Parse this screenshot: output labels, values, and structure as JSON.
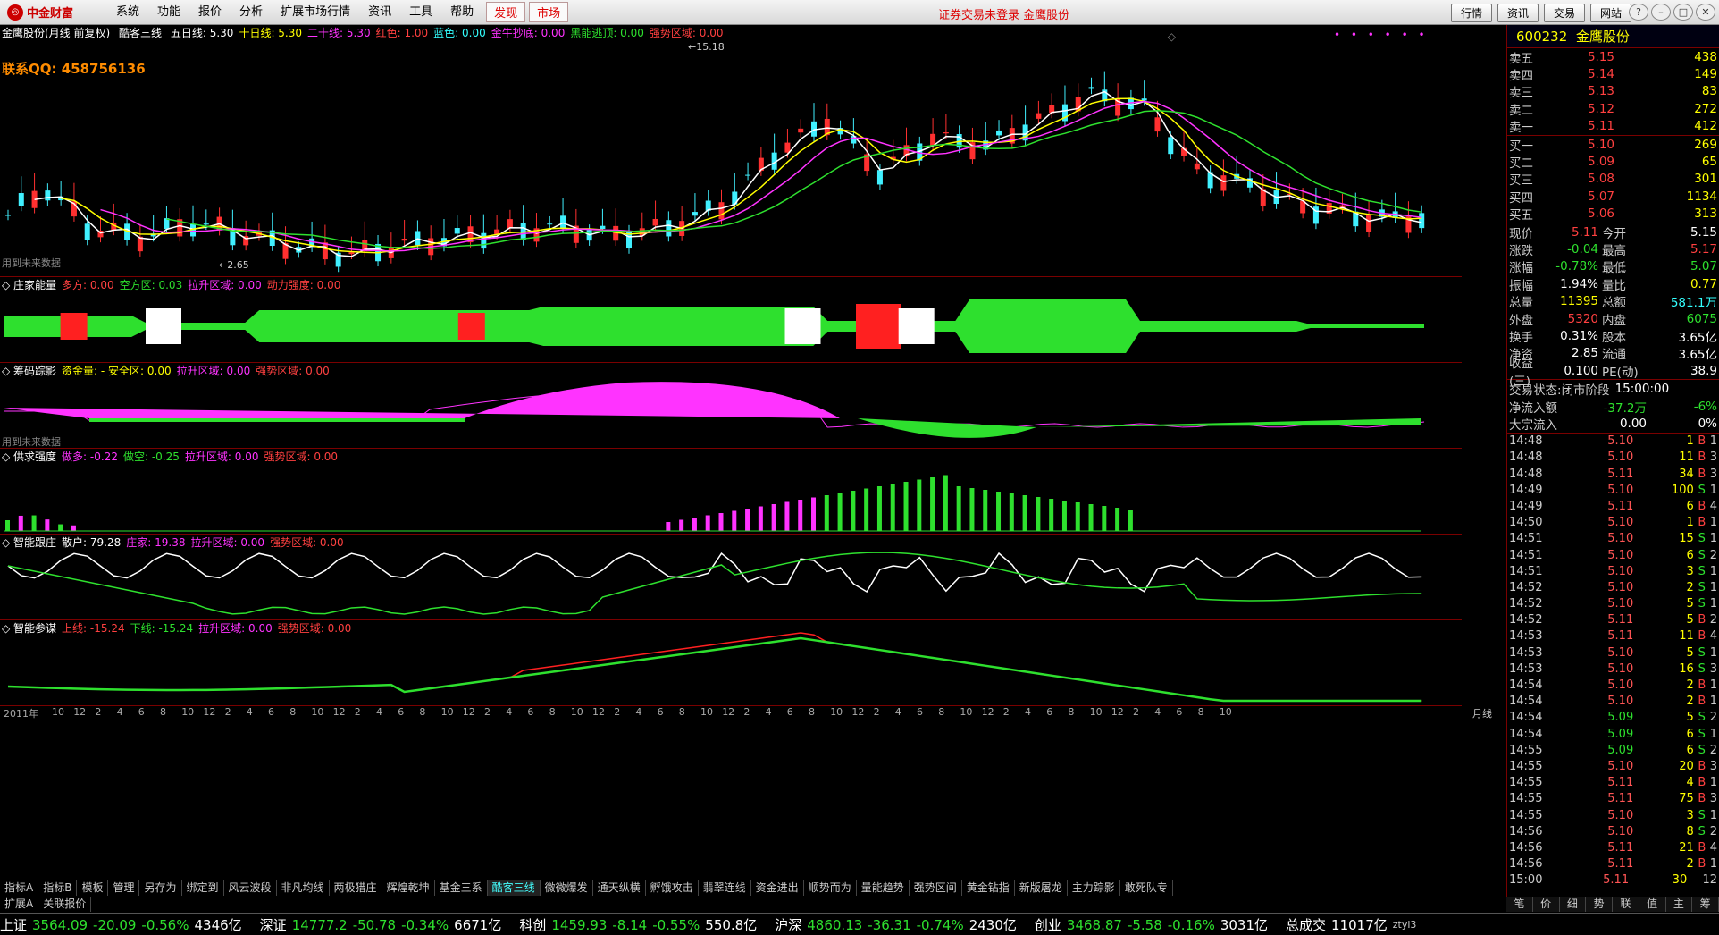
{
  "menu": {
    "logo": "中金财富",
    "items": [
      "系统",
      "功能",
      "报价",
      "分析",
      "扩展市场行情",
      "资讯",
      "工具",
      "帮助"
    ],
    "hot": [
      "发现",
      "市场"
    ],
    "login": "证券交易未登录 金鹰股份",
    "right_buttons": [
      "行情",
      "资讯",
      "交易",
      "网站"
    ]
  },
  "main": {
    "title": "金鹰股份(月线 前复权)",
    "indicator": "酷客三线",
    "lines": [
      {
        "t": "五日线: 5.30",
        "c": "#ffffff"
      },
      {
        "t": "十日线: 5.30",
        "c": "#ffff00"
      },
      {
        "t": "二十线: 5.30",
        "c": "#ff33ff"
      },
      {
        "t": "红色: 1.00",
        "c": "#ff4040"
      },
      {
        "t": "蓝色: 0.00",
        "c": "#33ffff"
      },
      {
        "t": "金牛抄底: 0.00",
        "c": "#ff33ff"
      },
      {
        "t": "黑能逃顶: 0.00",
        "c": "#2ee02e"
      },
      {
        "t": "强势区域: 0.00",
        "c": "#ff4040"
      }
    ],
    "contact": "联系QQ:  458756136",
    "high": "15.18",
    "low": "2.65",
    "future": "用到未来数据",
    "yscale": [
      "14.00",
      "12.00",
      "10.00",
      "8.00",
      "6.00",
      "4.00"
    ]
  },
  "panes": [
    {
      "name": "庄家能量",
      "lines": [
        {
          "t": "多方: 0.00",
          "c": "#ff4040"
        },
        {
          "t": "空方区: 0.03",
          "c": "#2ee02e"
        },
        {
          "t": "拉升区域: 0.00",
          "c": "#ff33ff"
        },
        {
          "t": "动力强度: 0.00",
          "c": "#ff4040"
        }
      ],
      "yscale": [
        "1.00",
        "0.00"
      ]
    },
    {
      "name": "筹码踪影",
      "lines": [
        {
          "t": "资金量: - 安全区: 0.00",
          "c": "#ffff00"
        },
        {
          "t": "拉升区域: 0.00",
          "c": "#ff33ff"
        },
        {
          "t": "强势区域: 0.00",
          "c": "#ff4040"
        }
      ],
      "yscale": [
        "3.00",
        "1.50"
      ],
      "future": "用到未来数据"
    },
    {
      "name": "供求强度",
      "lines": [
        {
          "t": "做多: -0.22",
          "c": "#ff33ff"
        },
        {
          "t": "做空: -0.25",
          "c": "#2ee02e"
        },
        {
          "t": "拉升区域: 0.00",
          "c": "#ff33ff"
        },
        {
          "t": "强势区域: 0.00",
          "c": "#ff4040"
        }
      ],
      "yscale": [
        "2.00",
        "1.00",
        "0.00"
      ]
    },
    {
      "name": "智能跟庄",
      "lines": [
        {
          "t": "散户: 79.28",
          "c": "#ffffff"
        },
        {
          "t": "庄家: 19.38",
          "c": "#ff33ff"
        },
        {
          "t": "拉升区域: 0.00",
          "c": "#ff33ff"
        },
        {
          "t": "强势区域: 0.00",
          "c": "#ff4040"
        }
      ],
      "yscale": [
        "75.00",
        "50.00",
        "25.00"
      ]
    },
    {
      "name": "智能参谋",
      "lines": [
        {
          "t": "上线: -15.24",
          "c": "#ff4040"
        },
        {
          "t": "下线: -15.24",
          "c": "#2ee02e"
        },
        {
          "t": "拉升区域: 0.00",
          "c": "#ff33ff"
        },
        {
          "t": "强势区域: 0.00",
          "c": "#ff4040"
        }
      ],
      "yscale": [
        "75.00",
        "50.00",
        "25.00"
      ]
    }
  ],
  "xaxis": {
    "first": "2011年",
    "period": "月线",
    "labels": [
      "10",
      "12",
      "2",
      "4",
      "6",
      "8",
      "10",
      "12",
      "2",
      "4",
      "6",
      "8",
      "10",
      "12",
      "2",
      "4",
      "6",
      "8",
      "10",
      "12",
      "2",
      "4",
      "6",
      "8",
      "10",
      "12",
      "2",
      "4",
      "6",
      "8",
      "10",
      "12",
      "2",
      "4",
      "6",
      "8",
      "10",
      "12",
      "2",
      "4",
      "6",
      "8",
      "10",
      "12",
      "2",
      "4",
      "6",
      "8",
      "10",
      "12",
      "2",
      "4",
      "6",
      "8",
      "10"
    ]
  },
  "tabs": [
    "指标A",
    "指标B",
    "模板",
    "管理",
    "另存为",
    "绑定到",
    "风云波段",
    "非凡均线",
    "两极猎庄",
    "辉煌乾坤",
    "基金三系",
    "酷客三线",
    "微微爆发",
    "通天纵横",
    "孵饿攻击",
    "翡翠连线",
    "资金进出",
    "顺势而为",
    "量能趋势",
    "强势区间",
    "黄金钻指",
    "新版屠龙",
    "主力踪影",
    "敢死队专"
  ],
  "active_tab": "酷客三线",
  "subtabs": [
    "扩展A",
    "关联报价"
  ],
  "right_tabs": [
    "笔",
    "价",
    "细",
    "势",
    "联",
    "值",
    "主",
    "筹"
  ],
  "quote": {
    "code": "600232",
    "name": "金鹰股份",
    "sells": [
      {
        "k": "卖五",
        "p": "5.15",
        "v": "438"
      },
      {
        "k": "卖四",
        "p": "5.14",
        "v": "149"
      },
      {
        "k": "卖三",
        "p": "5.13",
        "v": "83"
      },
      {
        "k": "卖二",
        "p": "5.12",
        "v": "272"
      },
      {
        "k": "卖一",
        "p": "5.11",
        "v": "412"
      }
    ],
    "buys": [
      {
        "k": "买一",
        "p": "5.10",
        "v": "269"
      },
      {
        "k": "买二",
        "p": "5.09",
        "v": "65"
      },
      {
        "k": "买三",
        "p": "5.08",
        "v": "301"
      },
      {
        "k": "买四",
        "p": "5.07",
        "v": "1134"
      },
      {
        "k": "买五",
        "p": "5.06",
        "v": "313"
      }
    ],
    "stats": [
      {
        "k": "现价",
        "v": "5.11",
        "vc": "#ff4040",
        "k2": "今开",
        "v2": "5.15",
        "v2c": "#ffffff"
      },
      {
        "k": "涨跌",
        "v": "-0.04",
        "vc": "#2ee02e",
        "k2": "最高",
        "v2": "5.17",
        "v2c": "#ff4040"
      },
      {
        "k": "涨幅",
        "v": "-0.78%",
        "vc": "#2ee02e",
        "k2": "最低",
        "v2": "5.07",
        "v2c": "#2ee02e"
      },
      {
        "k": "振幅",
        "v": "1.94%",
        "vc": "#ffffff",
        "k2": "量比",
        "v2": "0.77",
        "v2c": "#ffff00"
      },
      {
        "k": "总量",
        "v": "11395",
        "vc": "#ffff00",
        "k2": "总额",
        "v2": "581.1万",
        "v2c": "#33ffff"
      },
      {
        "k": "外盘",
        "v": "5320",
        "vc": "#ff4040",
        "k2": "内盘",
        "v2": "6075",
        "v2c": "#2ee02e"
      },
      {
        "k": "换手",
        "v": "0.31%",
        "vc": "#ffffff",
        "k2": "股本",
        "v2": "3.65亿",
        "v2c": "#ffffff"
      },
      {
        "k": "净资",
        "v": "2.85",
        "vc": "#ffffff",
        "k2": "流通",
        "v2": "3.65亿",
        "v2c": "#ffffff"
      },
      {
        "k": "收益(三)",
        "v": "0.100",
        "vc": "#ffffff",
        "k2": "PE(动)",
        "v2": "38.9",
        "v2c": "#ffffff"
      }
    ],
    "state_label": "交易状态:",
    "state": "闭市阶段",
    "state_time": "15:00:00",
    "flow": [
      {
        "k": "净流入额",
        "v": "-37.2万",
        "vc": "#2ee02e",
        "r": "-6%",
        "rc": "#2ee02e"
      },
      {
        "k": "大宗流入",
        "v": "0.00",
        "vc": "#ffffff",
        "r": "0%",
        "rc": "#ffffff"
      }
    ],
    "ticks": [
      [
        "14:48",
        "5.10",
        "1",
        "B",
        "1"
      ],
      [
        "14:48",
        "5.10",
        "11",
        "B",
        "3"
      ],
      [
        "14:48",
        "5.11",
        "34",
        "B",
        "3"
      ],
      [
        "14:49",
        "5.10",
        "100",
        "S",
        "1"
      ],
      [
        "14:49",
        "5.11",
        "6",
        "B",
        "4"
      ],
      [
        "14:50",
        "5.10",
        "1",
        "B",
        "1"
      ],
      [
        "14:51",
        "5.10",
        "15",
        "S",
        "1"
      ],
      [
        "14:51",
        "5.10",
        "6",
        "S",
        "2"
      ],
      [
        "14:51",
        "5.10",
        "3",
        "S",
        "1"
      ],
      [
        "14:52",
        "5.10",
        "2",
        "S",
        "1"
      ],
      [
        "14:52",
        "5.10",
        "5",
        "S",
        "1"
      ],
      [
        "14:52",
        "5.11",
        "5",
        "B",
        "2"
      ],
      [
        "14:53",
        "5.11",
        "11",
        "B",
        "4"
      ],
      [
        "14:53",
        "5.10",
        "5",
        "S",
        "1"
      ],
      [
        "14:53",
        "5.10",
        "16",
        "S",
        "3"
      ],
      [
        "14:54",
        "5.10",
        "2",
        "B",
        "1"
      ],
      [
        "14:54",
        "5.10",
        "2",
        "B",
        "1"
      ],
      [
        "14:54",
        "5.09",
        "5",
        "S",
        "2"
      ],
      [
        "14:54",
        "5.09",
        "6",
        "S",
        "1"
      ],
      [
        "14:55",
        "5.09",
        "6",
        "S",
        "2"
      ],
      [
        "14:55",
        "5.10",
        "20",
        "B",
        "3"
      ],
      [
        "14:55",
        "5.11",
        "4",
        "B",
        "1"
      ],
      [
        "14:55",
        "5.11",
        "75",
        "B",
        "3"
      ],
      [
        "14:55",
        "5.10",
        "3",
        "S",
        "1"
      ],
      [
        "14:56",
        "5.10",
        "8",
        "S",
        "2"
      ],
      [
        "14:56",
        "5.11",
        "21",
        "B",
        "4"
      ],
      [
        "14:56",
        "5.11",
        "2",
        "B",
        "1"
      ],
      [
        "15:00",
        "5.11",
        "30",
        "",
        "12"
      ]
    ]
  },
  "status": {
    "items": [
      {
        "n": "上证",
        "v": "3564.09",
        "c": "-20.09",
        "p": "-0.56%",
        "a": "4346亿"
      },
      {
        "n": "深证",
        "v": "14777.2",
        "c": "-50.78",
        "p": "-0.34%",
        "a": "6671亿"
      },
      {
        "n": "科创",
        "v": "1459.93",
        "c": "-8.14",
        "p": "-0.55%",
        "a": "550.8亿"
      },
      {
        "n": "沪深",
        "v": "4860.13",
        "c": "-36.31",
        "p": "-0.74%",
        "a": "2430亿"
      },
      {
        "n": "创业",
        "v": "3468.87",
        "c": "-5.58",
        "p": "-0.16%",
        "a": "3031亿"
      }
    ],
    "total_label": "总成交",
    "total": "11017亿",
    "user": "ztyl3"
  },
  "chart_data": {
    "type": "candlestick",
    "ylim": [
      2,
      16
    ],
    "high": 15.18,
    "low": 2.65,
    "last": 5.11
  }
}
